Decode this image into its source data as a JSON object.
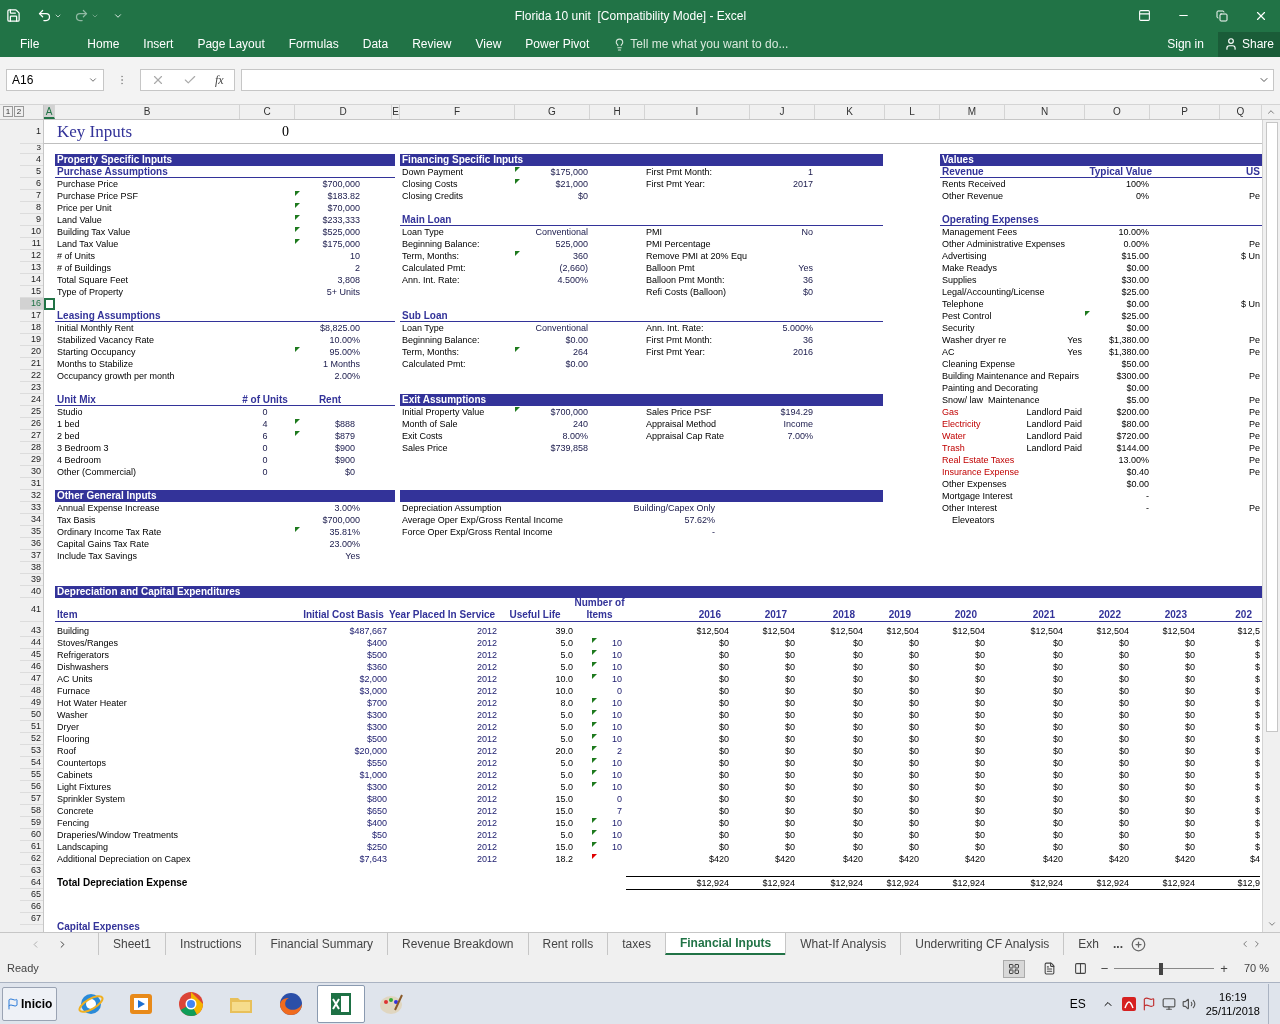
{
  "title_bar": {
    "title": "Florida 10 unit  [Compatibility Mode] - Excel"
  },
  "ribbon": {
    "tabs": [
      {
        "label": "File",
        "selected": false
      },
      {
        "label": "Home",
        "selected": false
      },
      {
        "label": "Insert",
        "selected": false
      },
      {
        "label": "Page Layout",
        "selected": false
      },
      {
        "label": "Formulas",
        "selected": false
      },
      {
        "label": "Data",
        "selected": false
      },
      {
        "label": "Review",
        "selected": false
      },
      {
        "label": "View",
        "selected": false
      },
      {
        "label": "Power Pivot",
        "selected": false
      }
    ],
    "tell_me": "Tell me what you want to do...",
    "sign_in": "Sign in",
    "share": "Share"
  },
  "formula_bar": {
    "name_box": "A16",
    "fx": "fx"
  },
  "outline_levels": [
    "1",
    "2"
  ],
  "columns": [
    {
      "label": "A",
      "selected": true
    },
    {
      "label": "B",
      "selected": false
    },
    {
      "label": "C",
      "selected": false
    },
    {
      "label": "D",
      "selected": false
    },
    {
      "label": "E",
      "selected": false
    },
    {
      "label": "F",
      "selected": false
    },
    {
      "label": "G",
      "selected": false
    },
    {
      "label": "H",
      "selected": false
    },
    {
      "label": "I",
      "selected": false
    },
    {
      "label": "J",
      "selected": false
    },
    {
      "label": "K",
      "selected": false
    },
    {
      "label": "L",
      "selected": false
    },
    {
      "label": "M",
      "selected": false
    },
    {
      "label": "N",
      "selected": false
    },
    {
      "label": "O",
      "selected": false
    },
    {
      "label": "P",
      "selected": false
    },
    {
      "label": "Q",
      "selected": false
    }
  ],
  "row_numbers": [
    {
      "label": "1",
      "selected": false
    },
    {
      "label": "3",
      "selected": false
    },
    {
      "label": "4",
      "selected": false
    },
    {
      "label": "5",
      "selected": false
    },
    {
      "label": "6",
      "selected": false
    },
    {
      "label": "7",
      "selected": false
    },
    {
      "label": "8",
      "selected": false
    },
    {
      "label": "9",
      "selected": false
    },
    {
      "label": "10",
      "selected": false
    },
    {
      "label": "11",
      "selected": false
    },
    {
      "label": "12",
      "selected": false
    },
    {
      "label": "13",
      "selected": false
    },
    {
      "label": "14",
      "selected": false
    },
    {
      "label": "15",
      "selected": false
    },
    {
      "label": "16",
      "selected": true
    },
    {
      "label": "17",
      "selected": false
    },
    {
      "label": "18",
      "selected": false
    },
    {
      "label": "19",
      "selected": false
    },
    {
      "label": "20",
      "selected": false
    },
    {
      "label": "21",
      "selected": false
    },
    {
      "label": "22",
      "selected": false
    },
    {
      "label": "23",
      "selected": false
    },
    {
      "label": "24",
      "selected": false
    },
    {
      "label": "25",
      "selected": false
    },
    {
      "label": "26",
      "selected": false
    },
    {
      "label": "27",
      "selected": false
    },
    {
      "label": "28",
      "selected": false
    },
    {
      "label": "29",
      "selected": false
    },
    {
      "label": "30",
      "selected": false
    },
    {
      "label": "31",
      "selected": false
    },
    {
      "label": "32",
      "selected": false
    },
    {
      "label": "33",
      "selected": false
    },
    {
      "label": "34",
      "selected": false
    },
    {
      "label": "35",
      "selected": false
    },
    {
      "label": "36",
      "selected": false
    },
    {
      "label": "37",
      "selected": false
    },
    {
      "label": "38",
      "selected": false
    },
    {
      "label": "39",
      "selected": false
    },
    {
      "label": "40",
      "selected": false
    },
    {
      "label": "41",
      "selected": false
    },
    {
      "label": "43",
      "selected": false
    },
    {
      "label": "44",
      "selected": false
    },
    {
      "label": "45",
      "selected": false
    },
    {
      "label": "46",
      "selected": false
    },
    {
      "label": "47",
      "selected": false
    },
    {
      "label": "48",
      "selected": false
    },
    {
      "label": "49",
      "selected": false
    },
    {
      "label": "50",
      "selected": false
    },
    {
      "label": "51",
      "selected": false
    },
    {
      "label": "52",
      "selected": false
    },
    {
      "label": "53",
      "selected": false
    },
    {
      "label": "54",
      "selected": false
    },
    {
      "label": "55",
      "selected": false
    },
    {
      "label": "56",
      "selected": false
    },
    {
      "label": "57",
      "selected": false
    },
    {
      "label": "58",
      "selected": false
    },
    {
      "label": "59",
      "selected": false
    },
    {
      "label": "60",
      "selected": false
    },
    {
      "label": "61",
      "selected": false
    },
    {
      "label": "62",
      "selected": false
    },
    {
      "label": "63",
      "selected": false
    },
    {
      "label": "64",
      "selected": false
    },
    {
      "label": "65",
      "selected": false
    },
    {
      "label": "66",
      "selected": false
    },
    {
      "label": "67",
      "selected": false
    }
  ],
  "sheet": {
    "title": "Key Inputs",
    "title_value": "0",
    "left": [
      {
        "kind": "band",
        "label": "Property Specific Inputs"
      },
      {
        "kind": "header",
        "label": "Purchase Assumptions"
      },
      {
        "kind": "field",
        "label": "Purchase Price",
        "value": "$700,000",
        "flag": false
      },
      {
        "kind": "field",
        "label": "Purchase Price PSF",
        "value": "$183.82",
        "flag": true
      },
      {
        "kind": "field",
        "label": "Price per Unit",
        "value": "$70,000",
        "flag": true
      },
      {
        "kind": "field",
        "label": "Land Value",
        "value": "$233,333",
        "flag": true
      },
      {
        "kind": "field",
        "label": "Building Tax Value",
        "value": "$525,000",
        "flag": true
      },
      {
        "kind": "field",
        "label": "Land Tax Value",
        "value": "$175,000",
        "flag": true
      },
      {
        "kind": "field",
        "label": "# of Units",
        "value": "10",
        "flag": false
      },
      {
        "kind": "field",
        "label": "# of Buildings",
        "value": "2",
        "flag": false
      },
      {
        "kind": "field",
        "label": "Total Square Feet",
        "value": "3,808",
        "flag": false
      },
      {
        "kind": "field",
        "label": "Type of Property",
        "value": "5+ Units",
        "flag": false
      },
      {
        "kind": "blank"
      },
      {
        "kind": "header",
        "label": "Leasing Assumptions"
      },
      {
        "kind": "field",
        "label": "Initial Monthly Rent",
        "value": "$8,825.00",
        "flag": false
      },
      {
        "kind": "field",
        "label": "Stabilized Vacancy Rate",
        "value": "10.00%",
        "flag": false
      },
      {
        "kind": "field",
        "label": "Starting Occupancy",
        "value": "95.00%",
        "flag": true
      },
      {
        "kind": "field",
        "label": "Months to Stabilize",
        "value": "1 Months",
        "flag": false
      },
      {
        "kind": "field",
        "label": "Occupancy growth per month",
        "value": "2.00%",
        "flag": false
      },
      {
        "kind": "blank"
      },
      {
        "kind": "mix_header",
        "label": "Unit Mix",
        "units": "# of Units",
        "rent": "Rent"
      },
      {
        "kind": "mix",
        "label": "Studio",
        "units": "0",
        "flag": false
      },
      {
        "kind": "mix",
        "label": "1 bed",
        "units": "4",
        "rent": "$888",
        "flag": true
      },
      {
        "kind": "mix",
        "label": "2 bed",
        "units": "6",
        "rent": "$879",
        "flag": true
      },
      {
        "kind": "mix",
        "label": "3 Bedroom 3",
        "units": "0",
        "rent": "$900",
        "flag": false
      },
      {
        "kind": "mix",
        "label": "4 Bedroom",
        "units": "0",
        "rent": "$900",
        "flag": false
      },
      {
        "kind": "mix",
        "label": "Other (Commercial)",
        "units": "0",
        "rent": "$0",
        "flag": false
      },
      {
        "kind": "blank"
      },
      {
        "kind": "band",
        "label": "Other General Inputs"
      },
      {
        "kind": "field",
        "label": "Annual Expense Increase",
        "value": "3.00%",
        "flag": false
      },
      {
        "kind": "field",
        "label": "Tax Basis",
        "value": "$700,000",
        "flag": false
      },
      {
        "kind": "field",
        "label": "Ordinary Income Tax Rate",
        "value": "35.81%",
        "flag": true
      },
      {
        "kind": "field",
        "label": "Capital Gains Tax Rate",
        "value": "23.00%",
        "flag": false
      },
      {
        "kind": "field",
        "label": "Include Tax Savings",
        "value": "Yes",
        "flag": false
      }
    ],
    "middle": [
      {
        "kind": "band",
        "label": "Financing Specific Inputs"
      },
      {
        "kind": "pair",
        "left": {
          "label": "Down Payment",
          "value": "$175,000",
          "flag": true
        },
        "right": {
          "label": "First Pmt Month:",
          "value": "1"
        }
      },
      {
        "kind": "pair",
        "left": {
          "label": "Closing Costs",
          "value": "$21,000",
          "flag": true
        },
        "right": {
          "label": "First Pmt Year:",
          "value": "2017"
        }
      },
      {
        "kind": "pair",
        "left": {
          "label": "Closing Credits",
          "value": "$0",
          "flag": false
        }
      },
      {
        "kind": "blank"
      },
      {
        "kind": "header",
        "label": "Main Loan"
      },
      {
        "kind": "pair",
        "left": {
          "label": "Loan Type",
          "value": "Conventional",
          "flag": false
        },
        "right": {
          "label": "PMI",
          "value": "No"
        }
      },
      {
        "kind": "pair",
        "left": {
          "label": "Beginning Balance:",
          "value": "525,000",
          "flag": false
        },
        "right": {
          "label": "PMI Percentage"
        }
      },
      {
        "kind": "pair",
        "left": {
          "label": "Term, Months:",
          "value": "360",
          "flag": true
        },
        "right": {
          "label": "Remove PMI at 20% Equ"
        }
      },
      {
        "kind": "pair",
        "left": {
          "label": "Calculated Pmt:",
          "value": "(2,660)",
          "flag": false
        },
        "right": {
          "label": "Balloon Pmt",
          "value": "Yes"
        }
      },
      {
        "kind": "pair",
        "left": {
          "label": "Ann. Int. Rate:",
          "value": "4.500%",
          "flag": false
        },
        "right": {
          "label": "Balloon Pmt Month:",
          "value": "36"
        }
      },
      {
        "kind": "pair",
        "right": {
          "label": "Refi Costs (Balloon)",
          "value": "$0"
        }
      },
      {
        "kind": "blank"
      },
      {
        "kind": "header",
        "label": "Sub Loan"
      },
      {
        "kind": "pair",
        "left": {
          "label": "Loan Type",
          "value": "Conventional",
          "flag": false
        },
        "right": {
          "label": "Ann. Int. Rate:",
          "value": "5.000%"
        }
      },
      {
        "kind": "pair",
        "left": {
          "label": "Beginning Balance:",
          "value": "$0.00",
          "flag": false
        },
        "right": {
          "label": "First Pmt Month:",
          "value": "36"
        }
      },
      {
        "kind": "pair",
        "left": {
          "label": "Term, Months:",
          "value": "264",
          "flag": true
        },
        "right": {
          "label": "First Pmt Year:",
          "value": "2016"
        }
      },
      {
        "kind": "pair",
        "left": {
          "label": "Calculated Pmt:",
          "value": "$0.00",
          "flag": false
        }
      },
      {
        "kind": "blank"
      },
      {
        "kind": "blank"
      },
      {
        "kind": "band",
        "label": "Exit Assumptions"
      },
      {
        "kind": "pair",
        "left": {
          "label": "Initial Property Value",
          "value": "$700,000",
          "flag": true
        },
        "right": {
          "label": "Sales Price PSF",
          "value": "$194.29"
        }
      },
      {
        "kind": "pair",
        "left": {
          "label": "Month of Sale",
          "value": "240",
          "flag": false
        },
        "right": {
          "label": "Appraisal Method",
          "value": "Income"
        }
      },
      {
        "kind": "pair",
        "left": {
          "label": "Exit Costs",
          "value": "8.00%",
          "flag": false
        },
        "right": {
          "label": "Appraisal Cap Rate",
          "value": "7.00%"
        }
      },
      {
        "kind": "pair",
        "left": {
          "label": "Sales Price",
          "value": "$739,858",
          "flag": false
        }
      },
      {
        "kind": "blank"
      },
      {
        "kind": "blank"
      },
      {
        "kind": "blank"
      },
      {
        "kind": "band"
      },
      {
        "kind": "wide",
        "label": "Depreciation Assumption",
        "value": "Building/Capex Only"
      },
      {
        "kind": "wide",
        "label": "Average Oper Exp/Gross Rental Income",
        "value": "57.62%"
      },
      {
        "kind": "wide",
        "label": "Force Oper Exp/Gross Rental Income",
        "value": "-"
      }
    ],
    "right": [
      {
        "kind": "band",
        "label": "Values"
      },
      {
        "kind": "header3",
        "label": "Revenue",
        "col2": "Typical Value",
        "col3": "US"
      },
      {
        "kind": "expense",
        "label": "Rents Received",
        "value": "100%",
        "flag": false,
        "alert": false
      },
      {
        "kind": "expense",
        "label": "Other Revenue",
        "value": "0%",
        "unit": "Pe",
        "flag": false,
        "alert": false
      },
      {
        "kind": "blank"
      },
      {
        "kind": "header",
        "label": "Operating Expenses"
      },
      {
        "kind": "expense",
        "label": "Management Fees",
        "value": "10.00%",
        "flag": false,
        "alert": false
      },
      {
        "kind": "expense",
        "label": "Other Administrative Expenses",
        "value": "0.00%",
        "unit": "Pe",
        "flag": false,
        "alert": false
      },
      {
        "kind": "expense",
        "label": "Advertising",
        "value": "$15.00",
        "unit": "$ Un",
        "flag": false,
        "alert": false
      },
      {
        "kind": "expense",
        "label": "Make Readys",
        "value": "$0.00",
        "flag": false,
        "alert": false
      },
      {
        "kind": "expense",
        "label": "Supplies",
        "value": "$30.00",
        "flag": false,
        "alert": false
      },
      {
        "kind": "expense",
        "label": "Legal/Accounting/License",
        "value": "$25.00",
        "flag": false,
        "alert": false
      },
      {
        "kind": "expense",
        "label": "Telephone",
        "value": "$0.00",
        "unit": "$ Un",
        "flag": false,
        "alert": false
      },
      {
        "kind": "expense",
        "label": "Pest Control",
        "value": "$25.00",
        "flag": true,
        "alert": false
      },
      {
        "kind": "expense",
        "label": "Security",
        "value": "$0.00",
        "flag": false,
        "alert": false
      },
      {
        "kind": "expense",
        "label": "Washer dryer re",
        "note": "Yes",
        "value": "$1,380.00",
        "unit": "Pe",
        "flag": false,
        "alert": false
      },
      {
        "kind": "expense",
        "label": "AC",
        "note": "Yes",
        "value": "$1,380.00",
        "unit": "Pe",
        "flag": false,
        "alert": false
      },
      {
        "kind": "expense",
        "label": "Cleaning Expense",
        "value": "$50.00",
        "flag": false,
        "alert": false
      },
      {
        "kind": "expense",
        "label": "Building Maintenance and Repairs",
        "value": "$300.00",
        "unit": "Pe",
        "flag": false,
        "alert": false
      },
      {
        "kind": "expense",
        "label": "Painting and Decorating",
        "value": "$0.00",
        "flag": false,
        "alert": false
      },
      {
        "kind": "expense",
        "label": "Snow/ law  Maintenance",
        "value": "$5.00",
        "unit": "Pe",
        "flag": false,
        "alert": false
      },
      {
        "kind": "expense",
        "label": "Gas",
        "note": "Landlord Paid",
        "value": "$200.00",
        "unit": "Pe",
        "flag": false,
        "alert": true
      },
      {
        "kind": "expense",
        "label": "Electricity",
        "note": "Landlord Paid",
        "value": "$80.00",
        "unit": "Pe",
        "flag": false,
        "alert": true
      },
      {
        "kind": "expense",
        "label": "Water",
        "note": "Landlord Paid",
        "value": "$720.00",
        "unit": "Pe",
        "flag": false,
        "alert": true
      },
      {
        "kind": "expense",
        "label": "Trash",
        "note": "Landlord Paid",
        "value": "$144.00",
        "unit": "Pe",
        "flag": false,
        "alert": true
      },
      {
        "kind": "expense",
        "label": "Real Estate Taxes",
        "value": "13.00%",
        "unit": "Pe",
        "flag": false,
        "alert": true
      },
      {
        "kind": "expense",
        "label": "Insurance Expense",
        "value": "$0.40",
        "unit": "Pe",
        "flag": false,
        "alert": true
      },
      {
        "kind": "expense",
        "label": "Other Expenses",
        "value": "$0.00",
        "flag": false,
        "alert": false
      },
      {
        "kind": "expense",
        "label": "Mortgage Interest",
        "value": "-",
        "flag": false,
        "alert": false
      },
      {
        "kind": "expense",
        "label": "Other Interest",
        "value": "-",
        "unit": "Pe",
        "flag": false,
        "alert": false
      },
      {
        "kind": "indent",
        "label": "Eleveators"
      }
    ],
    "depreciation": {
      "title": "Depreciation and Capital Expenditures",
      "headers": [
        "Item",
        "Initial Cost Basis",
        "Year Placed In Service",
        "Useful Life",
        "Number of Items",
        "2016",
        "2017",
        "2018",
        "2019",
        "2020",
        "2021",
        "2022",
        "2023",
        "202"
      ],
      "rows": [
        {
          "item": "Building",
          "cost": "$487,667",
          "year": "2012",
          "life": "39.0",
          "flag": false,
          "comment": false,
          "values": [
            "$12,504",
            "$12,504",
            "$12,504",
            "$12,504",
            "$12,504",
            "$12,504",
            "$12,504",
            "$12,504",
            "$12,5"
          ]
        },
        {
          "item": "Stoves/Ranges",
          "cost": "$400",
          "year": "2012",
          "life": "5.0",
          "flag": true,
          "comment": false,
          "count": "10",
          "values": [
            "$0",
            "$0",
            "$0",
            "$0",
            "$0",
            "$0",
            "$0",
            "$0",
            "$"
          ]
        },
        {
          "item": "Refrigerators",
          "cost": "$500",
          "year": "2012",
          "life": "5.0",
          "flag": true,
          "comment": false,
          "count": "10",
          "values": [
            "$0",
            "$0",
            "$0",
            "$0",
            "$0",
            "$0",
            "$0",
            "$0",
            "$"
          ]
        },
        {
          "item": "Dishwashers",
          "cost": "$360",
          "year": "2012",
          "life": "5.0",
          "flag": true,
          "comment": false,
          "count": "10",
          "values": [
            "$0",
            "$0",
            "$0",
            "$0",
            "$0",
            "$0",
            "$0",
            "$0",
            "$"
          ]
        },
        {
          "item": "AC Units",
          "cost": "$2,000",
          "year": "2012",
          "life": "10.0",
          "flag": true,
          "comment": false,
          "count": "10",
          "values": [
            "$0",
            "$0",
            "$0",
            "$0",
            "$0",
            "$0",
            "$0",
            "$0",
            "$"
          ]
        },
        {
          "item": "Furnace",
          "cost": "$3,000",
          "year": "2012",
          "life": "10.0",
          "flag": false,
          "comment": false,
          "count": "0",
          "values": [
            "$0",
            "$0",
            "$0",
            "$0",
            "$0",
            "$0",
            "$0",
            "$0",
            "$"
          ]
        },
        {
          "item": "Hot Water Heater",
          "cost": "$700",
          "year": "2012",
          "life": "8.0",
          "flag": true,
          "comment": false,
          "count": "10",
          "values": [
            "$0",
            "$0",
            "$0",
            "$0",
            "$0",
            "$0",
            "$0",
            "$0",
            "$"
          ]
        },
        {
          "item": "Washer",
          "cost": "$300",
          "year": "2012",
          "life": "5.0",
          "flag": true,
          "comment": false,
          "count": "10",
          "values": [
            "$0",
            "$0",
            "$0",
            "$0",
            "$0",
            "$0",
            "$0",
            "$0",
            "$"
          ]
        },
        {
          "item": "Dryer",
          "cost": "$300",
          "year": "2012",
          "life": "5.0",
          "flag": true,
          "comment": false,
          "count": "10",
          "values": [
            "$0",
            "$0",
            "$0",
            "$0",
            "$0",
            "$0",
            "$0",
            "$0",
            "$"
          ]
        },
        {
          "item": "Flooring",
          "cost": "$500",
          "year": "2012",
          "life": "5.0",
          "flag": true,
          "comment": false,
          "count": "10",
          "values": [
            "$0",
            "$0",
            "$0",
            "$0",
            "$0",
            "$0",
            "$0",
            "$0",
            "$"
          ]
        },
        {
          "item": "Roof",
          "cost": "$20,000",
          "year": "2012",
          "life": "20.0",
          "flag": true,
          "comment": false,
          "count": "2",
          "values": [
            "$0",
            "$0",
            "$0",
            "$0",
            "$0",
            "$0",
            "$0",
            "$0",
            "$"
          ]
        },
        {
          "item": "Countertops",
          "cost": "$550",
          "year": "2012",
          "life": "5.0",
          "flag": true,
          "comment": false,
          "count": "10",
          "values": [
            "$0",
            "$0",
            "$0",
            "$0",
            "$0",
            "$0",
            "$0",
            "$0",
            "$"
          ]
        },
        {
          "item": "Cabinets",
          "cost": "$1,000",
          "year": "2012",
          "life": "5.0",
          "flag": true,
          "comment": false,
          "count": "10",
          "values": [
            "$0",
            "$0",
            "$0",
            "$0",
            "$0",
            "$0",
            "$0",
            "$0",
            "$"
          ]
        },
        {
          "item": "Light Fixtures",
          "cost": "$300",
          "year": "2012",
          "life": "5.0",
          "flag": true,
          "comment": false,
          "count": "10",
          "values": [
            "$0",
            "$0",
            "$0",
            "$0",
            "$0",
            "$0",
            "$0",
            "$0",
            "$"
          ]
        },
        {
          "item": "Sprinkler System",
          "cost": "$800",
          "year": "2012",
          "life": "15.0",
          "flag": false,
          "comment": false,
          "count": "0",
          "values": [
            "$0",
            "$0",
            "$0",
            "$0",
            "$0",
            "$0",
            "$0",
            "$0",
            "$"
          ]
        },
        {
          "item": "Concrete",
          "cost": "$650",
          "year": "2012",
          "life": "15.0",
          "flag": false,
          "comment": false,
          "count": "7",
          "values": [
            "$0",
            "$0",
            "$0",
            "$0",
            "$0",
            "$0",
            "$0",
            "$0",
            "$"
          ]
        },
        {
          "item": "Fencing",
          "cost": "$400",
          "year": "2012",
          "life": "15.0",
          "flag": true,
          "comment": false,
          "count": "10",
          "values": [
            "$0",
            "$0",
            "$0",
            "$0",
            "$0",
            "$0",
            "$0",
            "$0",
            "$"
          ]
        },
        {
          "item": "Draperies/Window Treatments",
          "cost": "$50",
          "year": "2012",
          "life": "5.0",
          "flag": true,
          "comment": false,
          "count": "10",
          "values": [
            "$0",
            "$0",
            "$0",
            "$0",
            "$0",
            "$0",
            "$0",
            "$0",
            "$"
          ]
        },
        {
          "item": "Landscaping",
          "cost": "$250",
          "year": "2012",
          "life": "15.0",
          "flag": true,
          "comment": false,
          "count": "10",
          "values": [
            "$0",
            "$0",
            "$0",
            "$0",
            "$0",
            "$0",
            "$0",
            "$0",
            "$"
          ]
        },
        {
          "item": "Additional Depreciation on Capex",
          "cost": "$7,643",
          "year": "2012",
          "life": "18.2",
          "flag": false,
          "comment": true,
          "values": [
            "$420",
            "$420",
            "$420",
            "$420",
            "$420",
            "$420",
            "$420",
            "$420",
            "$4"
          ]
        }
      ],
      "total": {
        "label": "Total Depreciation Expense",
        "values": [
          "$12,924",
          "$12,924",
          "$12,924",
          "$12,924",
          "$12,924",
          "$12,924",
          "$12,924",
          "$12,924",
          "$12,9"
        ]
      },
      "next_title": "Capital Expenses"
    }
  },
  "sheet_tabs": [
    {
      "label": "Sheet1",
      "selected": false
    },
    {
      "label": "Instructions",
      "selected": false
    },
    {
      "label": "Financial Summary",
      "selected": false
    },
    {
      "label": "Revenue Breakdown",
      "selected": false
    },
    {
      "label": "Rent rolls",
      "selected": false
    },
    {
      "label": "taxes",
      "selected": false
    },
    {
      "label": "Financial Inputs",
      "selected": true
    },
    {
      "label": "What-If Analysis",
      "selected": false
    },
    {
      "label": "Underwriting CF Analysis",
      "selected": false
    },
    {
      "label": "Exh",
      "selected": false
    }
  ],
  "more_tabs": "...",
  "status_bar": {
    "text": "Ready",
    "minus": "−",
    "plus": "+",
    "zoom": {
      "level": 0.45,
      "reading": "70 %"
    }
  },
  "taskbar": {
    "start": "Inicio",
    "apps": [
      {
        "kind": "globe",
        "selected": false
      },
      {
        "kind": "player",
        "selected": false
      },
      {
        "kind": "wheel",
        "selected": false
      },
      {
        "kind": "folder",
        "selected": false
      },
      {
        "kind": "fox",
        "selected": false
      },
      {
        "kind": "sheet",
        "selected": true
      },
      {
        "kind": "palette",
        "selected": false
      }
    ],
    "language": "ES",
    "time": "16:19",
    "date": "25/11/2018"
  }
}
